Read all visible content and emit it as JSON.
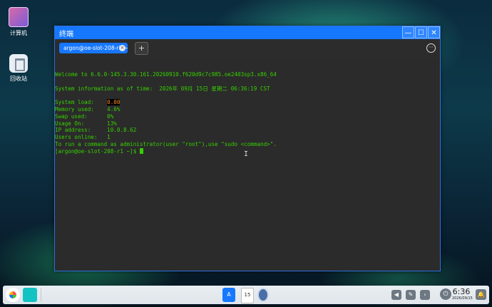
{
  "desktop": {
    "icons": [
      {
        "label": "计算机",
        "icon": "computer-icon"
      },
      {
        "label": "回收站",
        "icon": "recycle-bin-icon"
      }
    ]
  },
  "window": {
    "title": "终端",
    "buttons": {
      "minimize": "—",
      "maximize": "☐",
      "close": "✕"
    },
    "tab": {
      "label": "argon@oe-slot-208-r1:~",
      "close": "×"
    },
    "new_tab": "+",
    "menu": "⋯"
  },
  "terminal": {
    "welcome": "Welcome to 6.6.0-145.3.30.161.20260910.f620d9c7c985.oe2403sp3.x86_64",
    "sysinfo": "System information as of time:  2026年 09月 15日 星期二 06:36:19 CST",
    "load_label": "System load:    ",
    "load_value": "0.00",
    "memory": "Memory used:    4.6%",
    "swap": "Swap used:      0%",
    "usage": "Usage On:       13%",
    "ip": "IP address:     10.0.8.62",
    "users": "Users online:   1",
    "sudo_hint": "To run a command as administrator(user \"root\"),use \"sudo <command>\".",
    "prompt": "[argon@oe-slot-208-r1 ~]$ "
  },
  "taskbar": {
    "app_letter": "A",
    "calendar_day": "15",
    "time": "6:36",
    "date": "2026/09/15"
  }
}
